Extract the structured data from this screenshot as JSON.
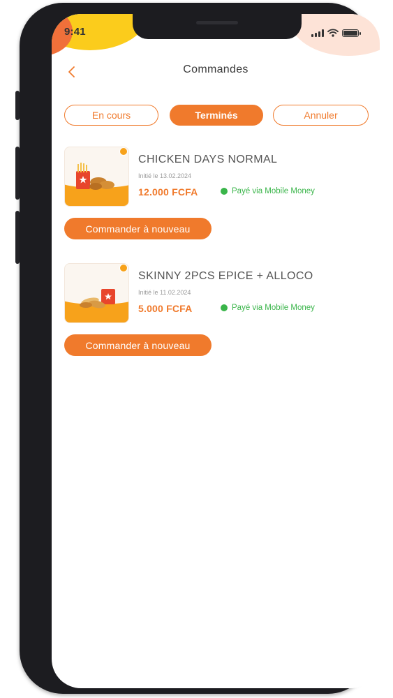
{
  "status_bar": {
    "time": "9:41"
  },
  "header": {
    "title": "Commandes"
  },
  "tabs": [
    {
      "label": "En cours",
      "active": false
    },
    {
      "label": "Terminés",
      "active": true
    },
    {
      "label": "Annuler",
      "active": false
    }
  ],
  "orders": [
    {
      "name": "CHICKEN DAYS NORMAL",
      "date": "Initié le 13.02.2024",
      "price": "12.000 FCFA",
      "payment_status": "Payé via Mobile Money",
      "reorder_label": "Commander à nouveau"
    },
    {
      "name": "SKINNY 2PCS EPICE + ALLOCO",
      "date": "Initié le 11.02.2024",
      "price": "5.000 FCFA",
      "payment_status": "Payé via Mobile Money",
      "reorder_label": "Commander à nouveau"
    }
  ],
  "colors": {
    "accent": "#f07a2c",
    "paid_green": "#3ab54a",
    "blob_yellow": "#fbcc1c",
    "blob_pink": "#fde3d7"
  },
  "icons": {
    "back": "chevron-left-icon",
    "signal": "signal-bars-icon",
    "wifi": "wifi-icon",
    "battery": "battery-icon"
  }
}
